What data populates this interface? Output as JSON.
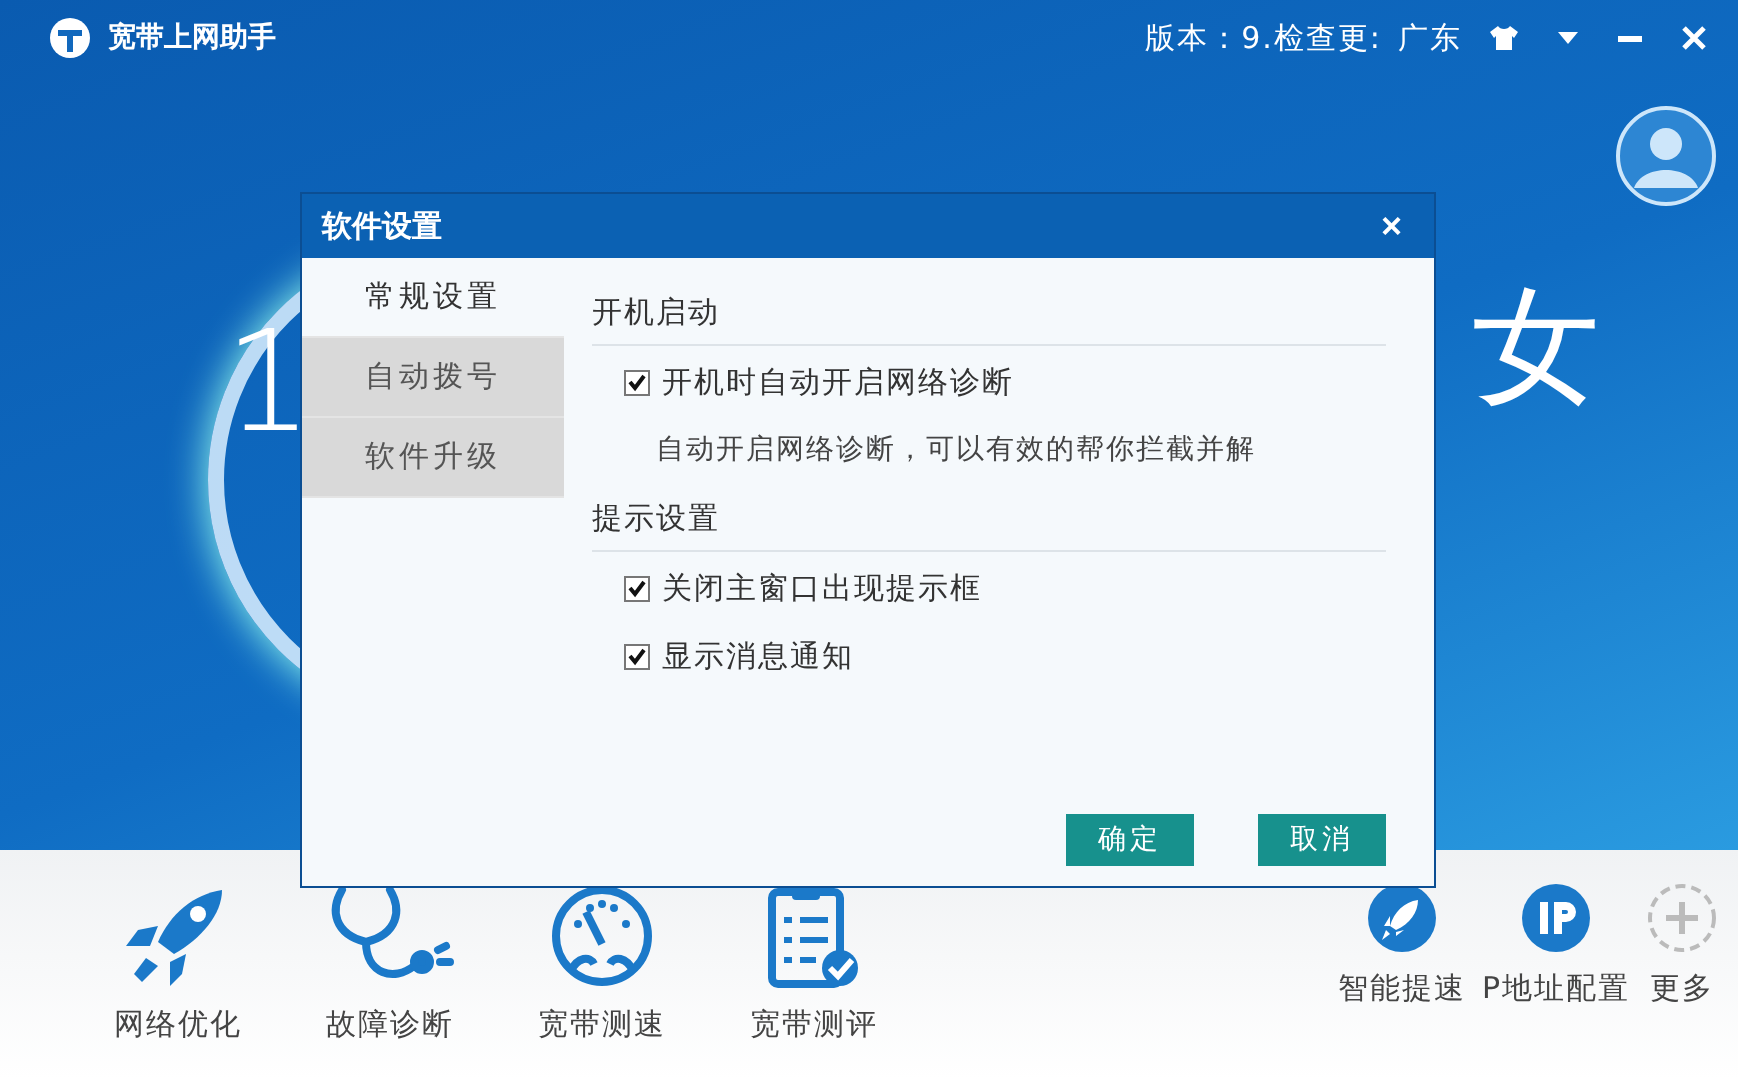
{
  "app": {
    "title": "宽带上网助手",
    "version": "版本：9.检查更:",
    "region": "广东"
  },
  "hero": {
    "left_digit": "1",
    "right_glyph": "女"
  },
  "dialog": {
    "title": "软件设置",
    "close": "×",
    "nav": [
      {
        "label": "常规设置",
        "selected": true
      },
      {
        "label": "自动拨号",
        "selected": false
      },
      {
        "label": "软件升级",
        "selected": false
      }
    ],
    "sections": [
      {
        "heading": "开机启动",
        "items": [
          {
            "kind": "checkbox",
            "label": "开机时自动开启网络诊断",
            "checked": true
          },
          {
            "kind": "note",
            "label": "自动开启网络诊断，可以有效的帮你拦截并解"
          }
        ]
      },
      {
        "heading": "提示设置",
        "items": [
          {
            "kind": "checkbox",
            "label": "关闭主窗口出现提示框",
            "checked": true
          },
          {
            "kind": "checkbox",
            "label": "显示消息通知",
            "checked": true
          }
        ]
      }
    ],
    "buttons": [
      "确定",
      "取消"
    ]
  },
  "tools": [
    {
      "kind": "rocket",
      "label": "网络优化"
    },
    {
      "kind": "stethoscope",
      "label": "故障诊断"
    },
    {
      "kind": "gauge",
      "label": "宽带测速"
    },
    {
      "kind": "clipboard",
      "label": "宽带测评"
    }
  ],
  "quick_tools": [
    {
      "kind": "rocket",
      "label": "智能提速"
    },
    {
      "kind": "ip",
      "label": "P地址配置"
    },
    {
      "kind": "plus",
      "label": "更多"
    }
  ]
}
